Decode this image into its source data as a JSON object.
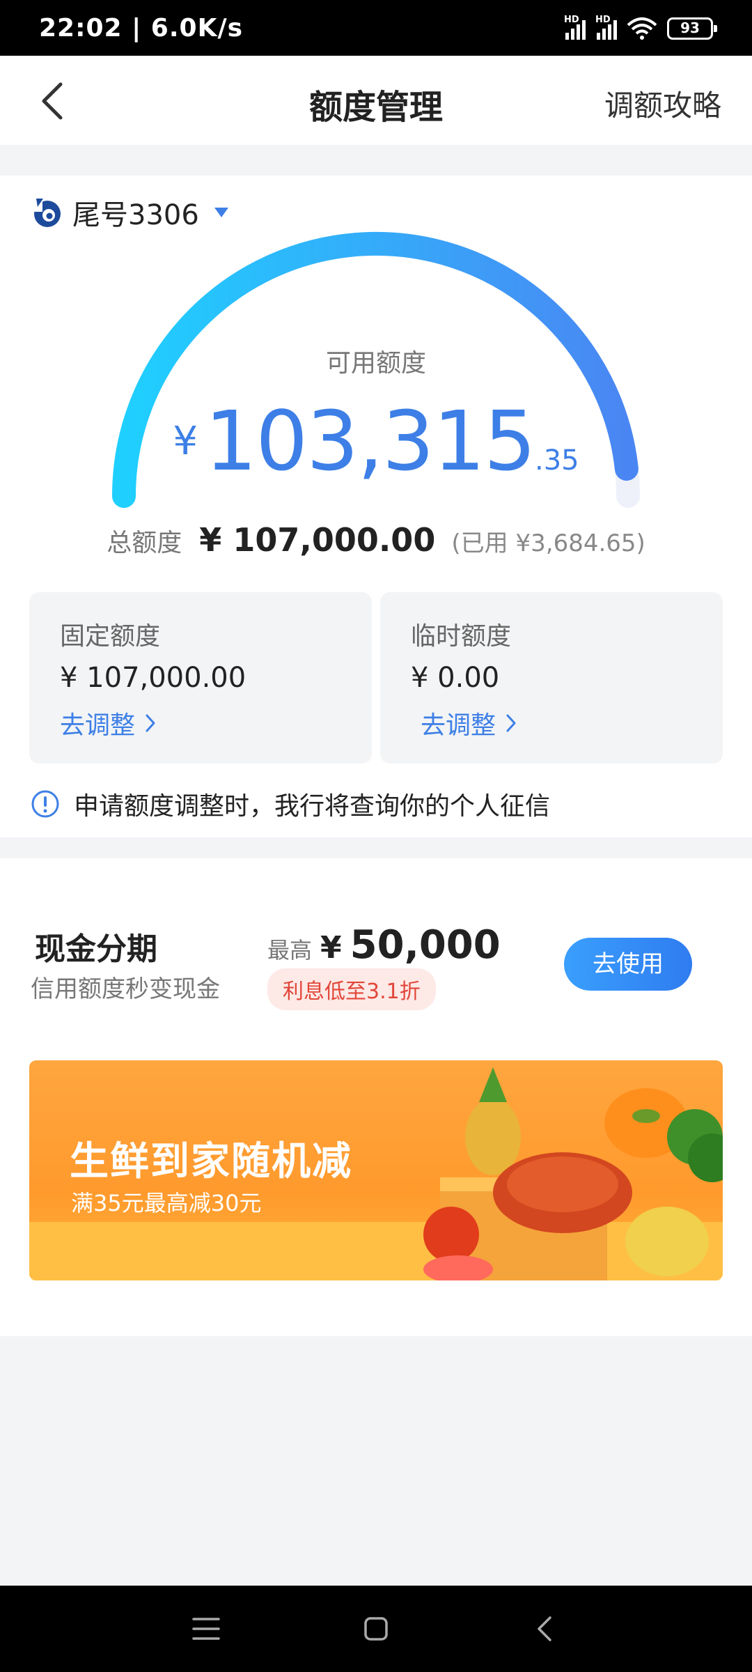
{
  "status_bar": {
    "time": "22:02 | 6.0K/s",
    "battery": "93",
    "signal_label": "HD"
  },
  "header": {
    "title": "额度管理",
    "guide_link": "调额攻略"
  },
  "account": {
    "label": "尾号3306"
  },
  "available": {
    "label": "可用额度",
    "currency": "¥",
    "integer": "103,315",
    "decimal": ".35"
  },
  "total": {
    "label": "总额度",
    "value": "¥ 107,000.00",
    "used": "(已用 ¥3,684.65)"
  },
  "fixed": {
    "title": "固定额度",
    "value": "¥ 107,000.00",
    "link": "去调整"
  },
  "temporary": {
    "title": "临时额度",
    "value": "¥ 0.00",
    "link": "去调整"
  },
  "notice": {
    "text": "申请额度调整时，我行将查询你的个人征信"
  },
  "cash": {
    "title": "现金分期",
    "subtitle": "信用额度秒变现金",
    "max_label": "最高",
    "max_currency": "¥",
    "max_value": "50,000",
    "tag": "利息低至3.1折",
    "button": "去使用"
  },
  "banner": {
    "title": "生鲜到家随机减",
    "subtitle": "满35元最高减30元"
  },
  "colors": {
    "accent": "#3d7fe6",
    "gauge_start": "#1fd0ff",
    "gauge_end": "#4a86f3",
    "tag_red": "#e2463a",
    "banner_orange": "#ffa63f"
  },
  "gauge": {
    "used_fraction": 0.0344
  }
}
